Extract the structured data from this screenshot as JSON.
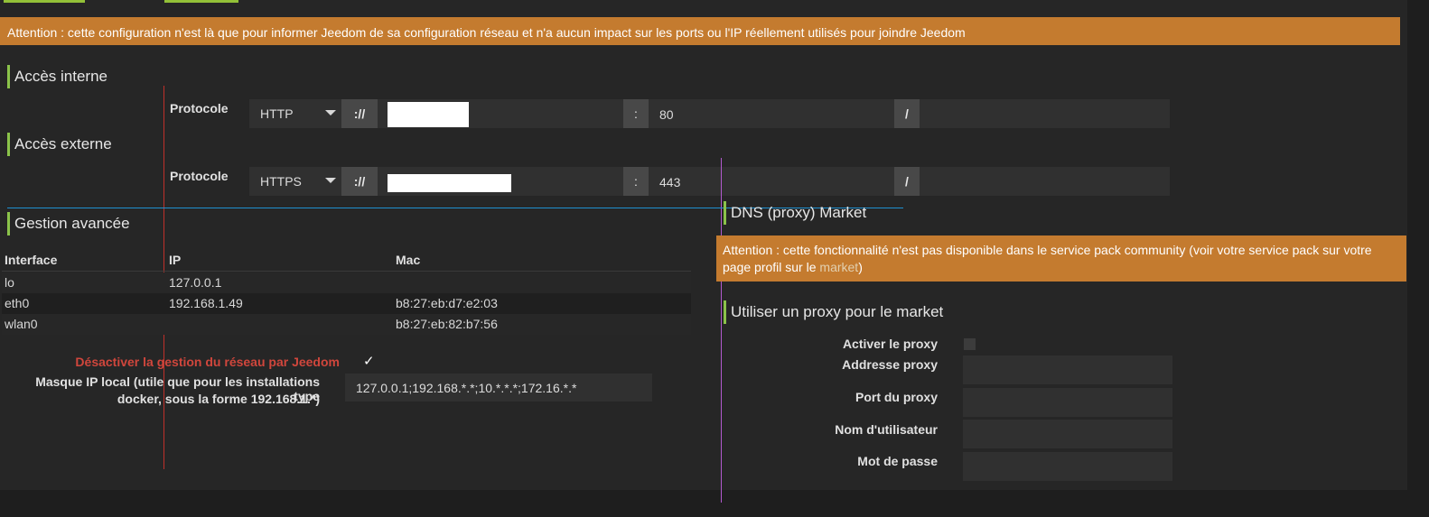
{
  "alert_network": "Attention : cette configuration n'est là que pour informer Jeedom de sa configuration réseau et n'a aucun impact sur les ports ou l'IP réellement utilisés pour joindre Jeedom",
  "internal": {
    "title": "Accès interne",
    "protocol_label": "Protocole",
    "protocol_value": "HTTP",
    "sep_scheme": "://",
    "sep_port": ":",
    "port": "80",
    "sep_path": "/"
  },
  "external": {
    "title": "Accès externe",
    "protocol_label": "Protocole",
    "protocol_value": "HTTPS",
    "sep_scheme": "://",
    "sep_port": ":",
    "port": "443",
    "sep_path": "/"
  },
  "advanced": {
    "title": "Gestion avancée",
    "headers": [
      "Interface",
      "IP",
      "Mac"
    ],
    "rows": [
      {
        "interface": "lo",
        "ip": "127.0.0.1",
        "mac": ""
      },
      {
        "interface": "eth0",
        "ip": "192.168.1.49",
        "mac": "b8:27:eb:d7:e2:03"
      },
      {
        "interface": "wlan0",
        "ip": "",
        "mac": "b8:27:eb:82:b7:56"
      }
    ],
    "disable_label": "Désactiver la gestion du réseau par Jeedom",
    "disable_checked": "✓",
    "mask_label_1": "Masque IP local (utile que pour les installations type",
    "mask_label_2": "docker, sous la forme 192.168.1.*)",
    "mask_value": "127.0.0.1;192.168.*.*;10.*.*.*;172.16.*.*"
  },
  "market": {
    "title": "DNS (proxy) Market",
    "alert_text": "Attention : cette fonctionnalité n'est pas disponible dans le service pack community (voir votre service pack sur votre page profil sur le ",
    "alert_link": "market",
    "alert_end": ")",
    "proxy_title": "Utiliser un proxy pour le market",
    "activate_label": "Activer le proxy",
    "address_label": "Addresse proxy",
    "port_label": "Port du proxy",
    "user_label": "Nom d'utilisateur",
    "password_label": "Mot de passe"
  },
  "colors": {
    "accent": "#8bc34a",
    "alert": "#c47b2f",
    "disable_label": "#d0463c"
  }
}
